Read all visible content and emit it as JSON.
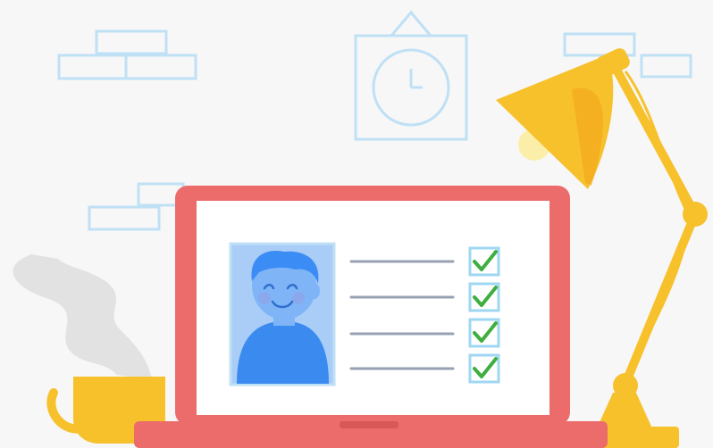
{
  "illustration": {
    "subject": "profile-verification",
    "colors": {
      "background": "#f7f7f7",
      "wall_outline": "#bfe0f5",
      "laptop_body": "#ec6b6b",
      "screen": "#ffffff",
      "avatar_bg": "#a9cdf7",
      "avatar_face": "#7fb5f7",
      "avatar_hair": "#3c8cf5",
      "avatar_shirt": "#3a8af0",
      "check_box": "#9fd7f2",
      "check_mark": "#3fae3f",
      "text_line": "#9aa0b4",
      "lamp": "#f7c12c",
      "lamp_shade_shadow": "#f2a51a",
      "mug": "#f7c12c",
      "steam": "#dedede"
    },
    "checklist": [
      {
        "checked": true
      },
      {
        "checked": true
      },
      {
        "checked": true
      },
      {
        "checked": true
      }
    ],
    "clock": {
      "hour": 12,
      "minute": 15
    }
  }
}
